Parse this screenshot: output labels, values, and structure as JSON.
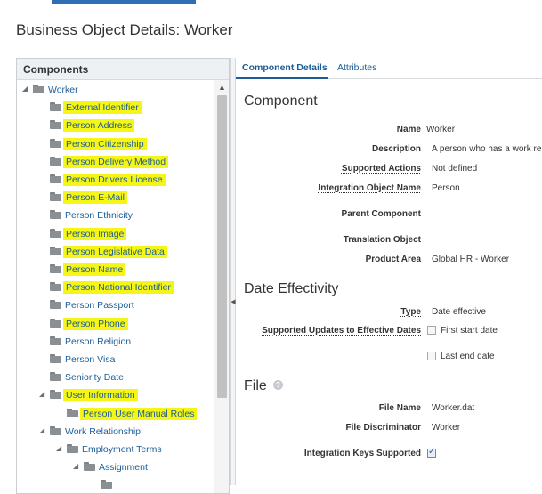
{
  "page_title": "Business Object Details: Worker",
  "left_panel": {
    "header": "Components",
    "tree": [
      {
        "label": "Worker",
        "level": 0,
        "toggle": "expanded",
        "highlighted": false
      },
      {
        "label": "External Identifier",
        "level": 1,
        "toggle": "none",
        "highlighted": true
      },
      {
        "label": "Person Address",
        "level": 1,
        "toggle": "none",
        "highlighted": true
      },
      {
        "label": "Person Citizenship",
        "level": 1,
        "toggle": "none",
        "highlighted": true
      },
      {
        "label": "Person Delivery Method",
        "level": 1,
        "toggle": "none",
        "highlighted": true
      },
      {
        "label": "Person Drivers License",
        "level": 1,
        "toggle": "none",
        "highlighted": true
      },
      {
        "label": "Person E-Mail",
        "level": 1,
        "toggle": "none",
        "highlighted": true
      },
      {
        "label": "Person Ethnicity",
        "level": 1,
        "toggle": "none",
        "highlighted": false
      },
      {
        "label": "Person Image",
        "level": 1,
        "toggle": "none",
        "highlighted": true
      },
      {
        "label": "Person Legislative Data",
        "level": 1,
        "toggle": "none",
        "highlighted": true
      },
      {
        "label": "Person Name",
        "level": 1,
        "toggle": "none",
        "highlighted": true
      },
      {
        "label": "Person National Identifier",
        "level": 1,
        "toggle": "none",
        "highlighted": true
      },
      {
        "label": "Person Passport",
        "level": 1,
        "toggle": "none",
        "highlighted": false
      },
      {
        "label": "Person Phone",
        "level": 1,
        "toggle": "none",
        "highlighted": true
      },
      {
        "label": "Person Religion",
        "level": 1,
        "toggle": "none",
        "highlighted": false
      },
      {
        "label": "Person Visa",
        "level": 1,
        "toggle": "none",
        "highlighted": false
      },
      {
        "label": "Seniority Date",
        "level": 1,
        "toggle": "none",
        "highlighted": false
      },
      {
        "label": "User Information",
        "level": 1,
        "toggle": "expanded",
        "highlighted": true
      },
      {
        "label": "Person User Manual Roles",
        "level": 2,
        "toggle": "none",
        "highlighted": true
      },
      {
        "label": "Work Relationship",
        "level": 1,
        "toggle": "expanded",
        "highlighted": false
      },
      {
        "label": "Employment Terms",
        "level": 2,
        "toggle": "expanded",
        "highlighted": false
      },
      {
        "label": "Assignment",
        "level": 3,
        "toggle": "expanded",
        "highlighted": false
      },
      {
        "label": "",
        "level": 4,
        "toggle": "none",
        "highlighted": false
      }
    ],
    "highlight_color": "#f5f516"
  },
  "tabs": [
    {
      "label": "Component Details",
      "active": true
    },
    {
      "label": "Attributes",
      "active": false
    }
  ],
  "component": {
    "title": "Component",
    "fields": {
      "name": {
        "label": "Name",
        "value": "Worker"
      },
      "description": {
        "label": "Description",
        "value": "A person who has a work re"
      },
      "supported_actions": {
        "label": "Supported Actions",
        "value": "Not defined"
      },
      "integration_object_name": {
        "label": "Integration Object Name",
        "value": "Person"
      },
      "parent_component": {
        "label": "Parent Component",
        "value": ""
      },
      "translation_object": {
        "label": "Translation Object",
        "value": ""
      },
      "product_area": {
        "label": "Product Area",
        "value": "Global HR - Worker"
      }
    }
  },
  "date_effectivity": {
    "title": "Date Effectivity",
    "type": {
      "label": "Type",
      "value": "Date effective"
    },
    "supported_updates": {
      "label": "Supported Updates to Effective Dates",
      "options": [
        {
          "label": "First start date",
          "checked": false
        },
        {
          "label": "Last end date",
          "checked": false
        }
      ]
    }
  },
  "file": {
    "title": "File",
    "help_icon": "?",
    "file_name": {
      "label": "File Name",
      "value": "Worker.dat"
    },
    "file_discriminator": {
      "label": "File Discriminator",
      "value": "Worker"
    },
    "integration_keys_supported": {
      "label": "Integration Keys Supported",
      "checked": true
    }
  },
  "colors": {
    "link": "#1c5d98",
    "accent": "#2f6db5"
  }
}
